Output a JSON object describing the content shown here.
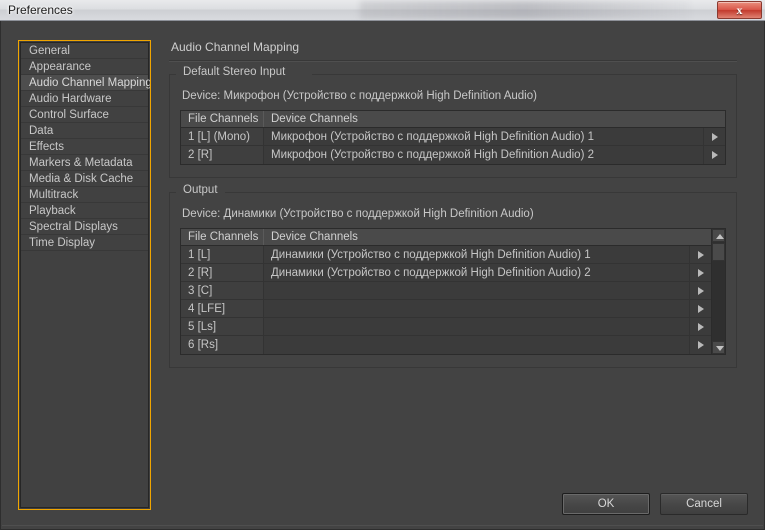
{
  "window": {
    "title": "Preferences",
    "close_label": "x"
  },
  "sidebar": {
    "items": [
      {
        "label": "General",
        "selected": false
      },
      {
        "label": "Appearance",
        "selected": false
      },
      {
        "label": "Audio Channel Mapping",
        "selected": true
      },
      {
        "label": "Audio Hardware",
        "selected": false
      },
      {
        "label": "Control Surface",
        "selected": false
      },
      {
        "label": "Data",
        "selected": false
      },
      {
        "label": "Effects",
        "selected": false
      },
      {
        "label": "Markers & Metadata",
        "selected": false
      },
      {
        "label": "Media & Disk Cache",
        "selected": false
      },
      {
        "label": "Multitrack",
        "selected": false
      },
      {
        "label": "Playback",
        "selected": false
      },
      {
        "label": "Spectral Displays",
        "selected": false
      },
      {
        "label": "Time Display",
        "selected": false
      }
    ]
  },
  "content": {
    "page_title": "Audio Channel Mapping",
    "groups": [
      {
        "legend": "Default Stereo Input",
        "device_line": "Device: Микрофон (Устройство с поддержкой High Definition Audio)",
        "columns": [
          "File Channels",
          "Device Channels"
        ],
        "rows": [
          {
            "file_channel": "1 [L] (Mono)",
            "device_channel": "Микрофон (Устройство с поддержкой High Definition Audio) 1"
          },
          {
            "file_channel": "2 [R]",
            "device_channel": "Микрофон (Устройство с поддержкой High Definition Audio) 2"
          }
        ],
        "scrollbar": false
      },
      {
        "legend": "Output",
        "device_line": "Device: Динамики (Устройство с поддержкой High Definition Audio)",
        "columns": [
          "File Channels",
          "Device Channels"
        ],
        "rows": [
          {
            "file_channel": "1 [L]",
            "device_channel": "Динамики (Устройство с поддержкой High Definition Audio) 1"
          },
          {
            "file_channel": "2 [R]",
            "device_channel": "Динамики (Устройство с поддержкой High Definition Audio) 2"
          },
          {
            "file_channel": "3 [C]",
            "device_channel": ""
          },
          {
            "file_channel": "4 [LFE]",
            "device_channel": ""
          },
          {
            "file_channel": "5 [Ls]",
            "device_channel": ""
          },
          {
            "file_channel": "6 [Rs]",
            "device_channel": ""
          }
        ],
        "scrollbar": true
      }
    ]
  },
  "footer": {
    "ok_label": "OK",
    "cancel_label": "Cancel"
  },
  "colors": {
    "focus_outline": "#f0a500",
    "dialog_bg": "#434343",
    "close_button": "#c23a2c",
    "text": "#c8c8c8"
  }
}
